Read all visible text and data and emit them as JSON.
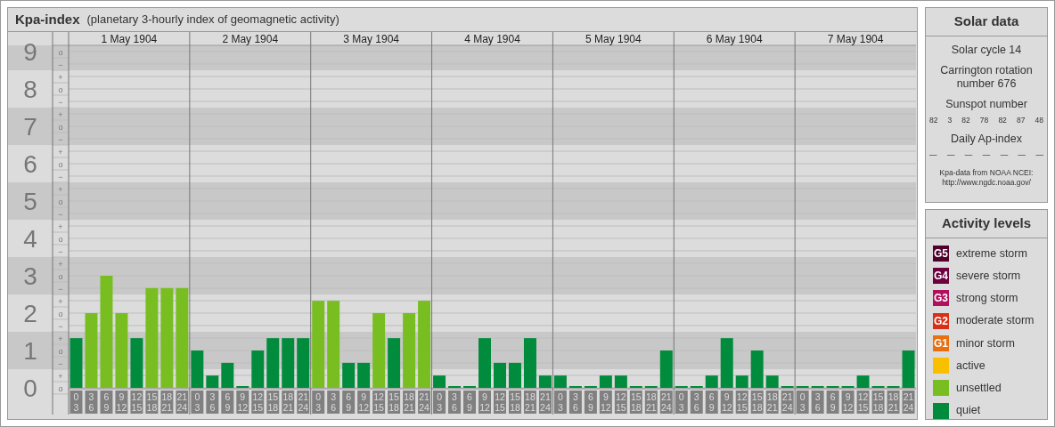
{
  "header": {
    "title": "Kpa-index",
    "subtitle": "(planetary 3-hourly index of geomagnetic activity)"
  },
  "chart": {
    "day_labels": [
      "1 May 1904",
      "2 May 1904",
      "3 May 1904",
      "4 May 1904",
      "5 May 1904",
      "6 May 1904",
      "7 May 1904"
    ],
    "minor_tick_labels": [
      "o",
      "−",
      "+",
      "o",
      "−",
      "+",
      "o",
      "−",
      "+",
      "o",
      "−",
      "+",
      "o",
      "−",
      "+",
      "o",
      "−",
      "+",
      "o",
      "−",
      "+",
      "o",
      "−",
      "+",
      "o",
      "−",
      "+",
      "o"
    ],
    "chart_data": {
      "type": "bar",
      "grid": true,
      "categories": [
        "0 3",
        "3 6",
        "6 9",
        "9 12",
        "12 15",
        "15 18",
        "18 21",
        "21 24",
        "0 3",
        "3 6",
        "6 9",
        "9 12",
        "12 15",
        "15 18",
        "18 21",
        "21 24",
        "0 3",
        "3 6",
        "6 9",
        "9 12",
        "12 15",
        "15 18",
        "18 21",
        "21 24",
        "0 3",
        "3 6",
        "6 9",
        "9 12",
        "12 15",
        "15 18",
        "18 21",
        "21 24",
        "0 3",
        "3 6",
        "6 9",
        "9 12",
        "12 15",
        "15 18",
        "18 21",
        "21 24",
        "0 3",
        "3 6",
        "6 9",
        "9 12",
        "12 15",
        "15 18",
        "18 21",
        "21 24",
        "0 3",
        "3 6",
        "6 9",
        "9 12",
        "12 15",
        "15 18",
        "18 21",
        "21 24"
      ],
      "series": [
        {
          "color": "#78be20",
          "values": [
            null,
            2,
            3,
            2,
            null,
            2.67,
            2.67,
            2.67,
            null,
            null,
            null,
            null,
            null,
            null,
            null,
            null,
            2.33,
            2.33,
            null,
            null,
            2,
            null,
            2,
            2.33,
            null,
            null,
            null,
            null,
            null,
            null,
            null,
            null,
            null,
            null,
            null,
            null,
            null,
            null,
            null,
            null,
            null,
            null,
            null,
            null,
            null,
            null,
            null,
            null,
            null,
            null,
            null,
            null,
            null,
            null,
            null,
            null
          ]
        },
        {
          "color": "#008c3c",
          "values": [
            1.33,
            null,
            null,
            null,
            1.33,
            null,
            null,
            null,
            1,
            0.33,
            0.67,
            0,
            1,
            1.33,
            1.33,
            1.33,
            null,
            null,
            0.67,
            0.67,
            null,
            1.33,
            null,
            null,
            0.33,
            0,
            0,
            1.33,
            0.67,
            0.67,
            1.33,
            0.33,
            0.33,
            0,
            0,
            0.33,
            0.33,
            0,
            0,
            1,
            0,
            0,
            0.33,
            1.33,
            0.33,
            1,
            0.33,
            0,
            0,
            0,
            0,
            0,
            0.33,
            0,
            0,
            1
          ]
        }
      ],
      "ylim": [
        0,
        9
      ],
      "yticks": [
        {
          "value": 9,
          "label": "9"
        },
        {
          "value": 8,
          "label": "8"
        },
        {
          "value": 7,
          "label": "7"
        },
        {
          "value": 6,
          "label": "6"
        },
        {
          "value": 5,
          "label": "5"
        },
        {
          "value": 4,
          "label": "4"
        },
        {
          "value": 3,
          "label": "3"
        },
        {
          "value": 2,
          "label": "2"
        },
        {
          "value": 1,
          "label": "1"
        },
        {
          "value": 0,
          "label": "0"
        }
      ]
    }
  },
  "solar_data": {
    "title": "Solar data",
    "solar_cycle": "Solar cycle 14",
    "carrington": "Carrington rotation number 676",
    "sunspot_heading": "Sunspot number",
    "sunspot_numbers": [
      "82",
      "3",
      "82",
      "78",
      "82",
      "87",
      "48"
    ],
    "ap_heading": "Daily Ap-index",
    "ap_values": [
      "—",
      "—",
      "—",
      "—",
      "—",
      "—",
      "—"
    ],
    "source_note": "Kpa-data from NOAA NCEI:",
    "source_url": "http://www.ngdc.noaa.gov/"
  },
  "activity_levels": {
    "title": "Activity levels",
    "items": [
      {
        "code": "G5",
        "label": "extreme storm",
        "color": "#50002a"
      },
      {
        "code": "G4",
        "label": "severe storm",
        "color": "#6e0040"
      },
      {
        "code": "G3",
        "label": "strong storm",
        "color": "#b0105e"
      },
      {
        "code": "G2",
        "label": "moderate storm",
        "color": "#d83018"
      },
      {
        "code": "G1",
        "label": "minor storm",
        "color": "#e87010"
      },
      {
        "label": "active",
        "color": "#f8c000"
      },
      {
        "label": "unsettled",
        "color": "#78be20"
      },
      {
        "label": "quiet",
        "color": "#008c3c"
      }
    ]
  }
}
